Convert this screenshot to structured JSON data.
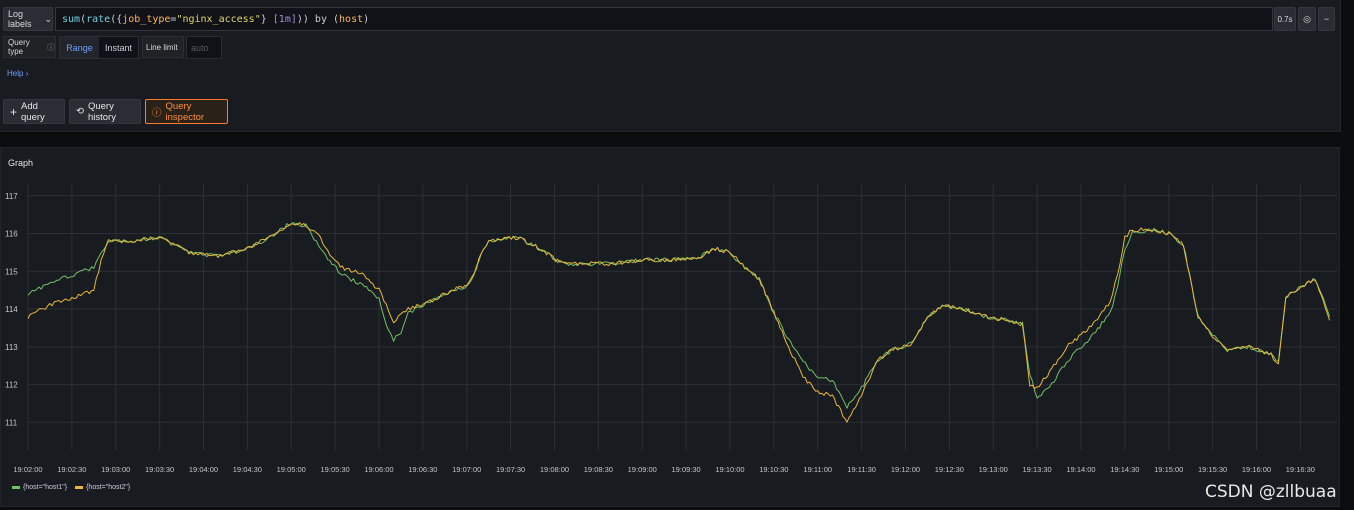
{
  "toolbar": {
    "log_labels": "Log labels",
    "query_tokens": [
      {
        "text": "sum",
        "cls": "tok-fn"
      },
      {
        "text": "(",
        "cls": "tok-brace"
      },
      {
        "text": "rate",
        "cls": "tok-fn"
      },
      {
        "text": "({",
        "cls": "tok-brace"
      },
      {
        "text": "job_type",
        "cls": "tok-label"
      },
      {
        "text": "=",
        "cls": "tok-brace"
      },
      {
        "text": "\"nginx_access\"",
        "cls": "tok-str"
      },
      {
        "text": "} ",
        "cls": "tok-brace"
      },
      {
        "text": "[1m]",
        "cls": "tok-range"
      },
      {
        "text": ")) by (",
        "cls": "tok-brace"
      },
      {
        "text": "host",
        "cls": "tok-label"
      },
      {
        "text": ")",
        "cls": "tok-brace"
      }
    ],
    "duration": "0.7s"
  },
  "options": {
    "query_type_label": "Query type",
    "range_label": "Range",
    "instant_label": "Instant",
    "line_limit_label": "Line limit",
    "line_limit_placeholder": "auto",
    "help_label": "Help"
  },
  "actions": {
    "add_query": "Add query",
    "query_history": "Query history",
    "query_inspector": "Query inspector"
  },
  "graph": {
    "title": "Graph"
  },
  "chart_data": {
    "type": "line",
    "x_ticks": [
      "19:02:00",
      "19:02:30",
      "19:03:00",
      "19:03:30",
      "19:04:00",
      "19:04:30",
      "19:05:00",
      "19:05:30",
      "19:06:00",
      "19:06:30",
      "19:07:00",
      "19:07:30",
      "19:08:00",
      "19:08:30",
      "19:09:00",
      "19:09:30",
      "19:10:00",
      "19:10:30",
      "19:11:00",
      "19:11:30",
      "19:12:00",
      "19:12:30",
      "19:13:00",
      "19:13:30",
      "19:14:00",
      "19:14:30",
      "19:15:00",
      "19:15:30",
      "19:16:00",
      "19:16:30"
    ],
    "y_ticks": [
      111,
      112,
      113,
      114,
      115,
      116,
      117
    ],
    "ylim": [
      110.4,
      117.1
    ],
    "x_range_seconds": [
      0,
      880
    ],
    "grid": true,
    "legend_position": "bottom-left",
    "series": [
      {
        "name": "{host=\"host1\"}",
        "color": "#73bf69",
        "points": [
          [
            0,
            114.4
          ],
          [
            15,
            114.7
          ],
          [
            30,
            114.9
          ],
          [
            45,
            115.1
          ],
          [
            50,
            115.5
          ],
          [
            55,
            115.8
          ],
          [
            70,
            115.8
          ],
          [
            90,
            115.9
          ],
          [
            110,
            115.5
          ],
          [
            130,
            115.4
          ],
          [
            150,
            115.6
          ],
          [
            165,
            115.9
          ],
          [
            180,
            116.3
          ],
          [
            190,
            116.2
          ],
          [
            200,
            115.6
          ],
          [
            205,
            115.3
          ],
          [
            215,
            114.9
          ],
          [
            230,
            114.6
          ],
          [
            240,
            114.3
          ],
          [
            245,
            113.6
          ],
          [
            250,
            113.2
          ],
          [
            255,
            113.4
          ],
          [
            260,
            113.9
          ],
          [
            275,
            114.2
          ],
          [
            290,
            114.5
          ],
          [
            300,
            114.6
          ],
          [
            305,
            114.9
          ],
          [
            310,
            115.5
          ],
          [
            315,
            115.8
          ],
          [
            335,
            115.9
          ],
          [
            350,
            115.6
          ],
          [
            365,
            115.2
          ],
          [
            385,
            115.2
          ],
          [
            400,
            115.2
          ],
          [
            420,
            115.3
          ],
          [
            440,
            115.3
          ],
          [
            460,
            115.4
          ],
          [
            470,
            115.6
          ],
          [
            480,
            115.5
          ],
          [
            490,
            115.1
          ],
          [
            500,
            114.8
          ],
          [
            510,
            113.9
          ],
          [
            520,
            113.2
          ],
          [
            530,
            112.6
          ],
          [
            540,
            112.2
          ],
          [
            550,
            112.1
          ],
          [
            560,
            111.4
          ],
          [
            570,
            111.9
          ],
          [
            580,
            112.6
          ],
          [
            590,
            112.9
          ],
          [
            605,
            113.1
          ],
          [
            615,
            113.8
          ],
          [
            625,
            114.1
          ],
          [
            640,
            114.0
          ],
          [
            655,
            113.8
          ],
          [
            670,
            113.7
          ],
          [
            680,
            113.6
          ],
          [
            685,
            112.3
          ],
          [
            690,
            111.6
          ],
          [
            700,
            112.0
          ],
          [
            710,
            112.6
          ],
          [
            720,
            113.0
          ],
          [
            730,
            113.4
          ],
          [
            740,
            113.9
          ],
          [
            745,
            114.6
          ],
          [
            750,
            115.6
          ],
          [
            755,
            116.0
          ],
          [
            770,
            116.1
          ],
          [
            780,
            116.0
          ],
          [
            790,
            115.7
          ],
          [
            800,
            113.8
          ],
          [
            810,
            113.3
          ],
          [
            820,
            112.9
          ],
          [
            835,
            113.0
          ],
          [
            850,
            112.8
          ],
          [
            855,
            112.6
          ],
          [
            860,
            114.3
          ],
          [
            870,
            114.6
          ],
          [
            880,
            114.8
          ],
          [
            890,
            113.8
          ]
        ]
      },
      {
        "name": "{host=\"host2\"}",
        "color": "#eab839",
        "points": [
          [
            0,
            113.8
          ],
          [
            15,
            114.1
          ],
          [
            30,
            114.3
          ],
          [
            45,
            114.5
          ],
          [
            50,
            115.3
          ],
          [
            55,
            115.8
          ],
          [
            70,
            115.8
          ],
          [
            90,
            115.9
          ],
          [
            110,
            115.5
          ],
          [
            130,
            115.4
          ],
          [
            150,
            115.6
          ],
          [
            165,
            115.9
          ],
          [
            180,
            116.3
          ],
          [
            190,
            116.2
          ],
          [
            200,
            115.9
          ],
          [
            205,
            115.5
          ],
          [
            215,
            115.1
          ],
          [
            230,
            114.9
          ],
          [
            240,
            114.5
          ],
          [
            245,
            114.1
          ],
          [
            250,
            113.6
          ],
          [
            255,
            113.9
          ],
          [
            260,
            114.0
          ],
          [
            275,
            114.2
          ],
          [
            290,
            114.5
          ],
          [
            300,
            114.6
          ],
          [
            305,
            114.9
          ],
          [
            310,
            115.5
          ],
          [
            315,
            115.8
          ],
          [
            335,
            115.9
          ],
          [
            350,
            115.6
          ],
          [
            365,
            115.2
          ],
          [
            385,
            115.2
          ],
          [
            400,
            115.2
          ],
          [
            420,
            115.3
          ],
          [
            440,
            115.3
          ],
          [
            460,
            115.4
          ],
          [
            470,
            115.6
          ],
          [
            480,
            115.5
          ],
          [
            490,
            115.1
          ],
          [
            500,
            114.8
          ],
          [
            510,
            113.9
          ],
          [
            520,
            113.0
          ],
          [
            530,
            112.2
          ],
          [
            540,
            111.8
          ],
          [
            550,
            111.7
          ],
          [
            560,
            111.0
          ],
          [
            570,
            111.7
          ],
          [
            580,
            112.6
          ],
          [
            590,
            112.9
          ],
          [
            605,
            113.1
          ],
          [
            615,
            113.8
          ],
          [
            625,
            114.1
          ],
          [
            640,
            114.0
          ],
          [
            655,
            113.8
          ],
          [
            670,
            113.7
          ],
          [
            680,
            113.6
          ],
          [
            685,
            112.0
          ],
          [
            690,
            111.9
          ],
          [
            700,
            112.4
          ],
          [
            710,
            113.0
          ],
          [
            720,
            113.3
          ],
          [
            730,
            113.7
          ],
          [
            740,
            114.2
          ],
          [
            745,
            114.9
          ],
          [
            750,
            115.9
          ],
          [
            755,
            116.1
          ],
          [
            770,
            116.1
          ],
          [
            780,
            116.0
          ],
          [
            790,
            115.7
          ],
          [
            800,
            113.8
          ],
          [
            810,
            113.3
          ],
          [
            820,
            112.9
          ],
          [
            835,
            113.0
          ],
          [
            850,
            112.8
          ],
          [
            855,
            112.5
          ],
          [
            860,
            114.3
          ],
          [
            870,
            114.6
          ],
          [
            880,
            114.8
          ],
          [
            890,
            113.7
          ]
        ]
      }
    ]
  },
  "watermark": "CSDN @zllbuaa"
}
